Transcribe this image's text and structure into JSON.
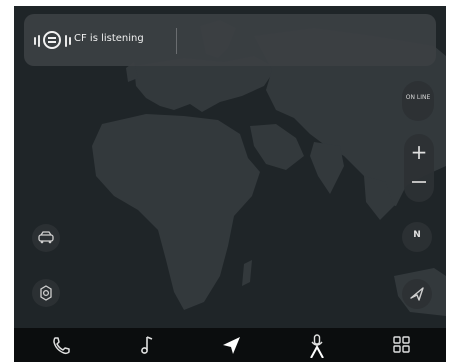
{
  "banner": {
    "text": "CF is listening"
  },
  "map_controls": {
    "online_label": "ON LINE",
    "zoom_in_label": "+",
    "compass_label": "N"
  },
  "nav": {
    "items": [
      {
        "icon": "phone-icon"
      },
      {
        "icon": "music-icon"
      },
      {
        "icon": "navigation-icon",
        "active": true
      },
      {
        "icon": "microphone-icon"
      },
      {
        "icon": "apps-grid-icon"
      }
    ]
  },
  "colors": {
    "map_water": "#1f2528",
    "map_land": "#33393c",
    "nav_bar": "#0b0d0e",
    "banner": "#3c4043"
  }
}
